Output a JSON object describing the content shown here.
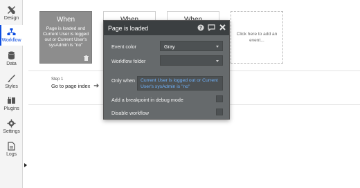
{
  "sidebar": {
    "items": [
      {
        "label": "Design",
        "icon": "design-icon"
      },
      {
        "label": "Workflow",
        "icon": "workflow-icon",
        "active": true
      },
      {
        "label": "Data",
        "icon": "data-icon"
      },
      {
        "label": "Styles",
        "icon": "styles-icon"
      },
      {
        "label": "Plugins",
        "icon": "plugins-icon"
      },
      {
        "label": "Settings",
        "icon": "settings-icon"
      },
      {
        "label": "Logs",
        "icon": "logs-icon"
      }
    ]
  },
  "events": [
    {
      "title": "When",
      "description": "Page is loaded and Current User is logged out or Current User's sysAdmin is \"no\""
    },
    {
      "title": "When"
    },
    {
      "title": "When"
    }
  ],
  "add_event": {
    "label": "Click here to add an event..."
  },
  "step": {
    "number": "Step 1",
    "action": "Go to page index"
  },
  "popup": {
    "title": "Page is loaded",
    "event_color_label": "Event color",
    "event_color_value": "Gray",
    "workflow_folder_label": "Workflow folder",
    "workflow_folder_value": "",
    "only_when_label": "Only when",
    "only_when_value": "Current User is logged out or Current User's sysAdmin is \"no\"",
    "breakpoint_label": "Add a breakpoint in debug mode",
    "disable_label": "Disable workflow"
  },
  "colors": {
    "accent": "#0d4de0",
    "active_event": "#8d8d8d",
    "popup_bg": "#666a6c",
    "condition_text": "#6fb4ff"
  }
}
